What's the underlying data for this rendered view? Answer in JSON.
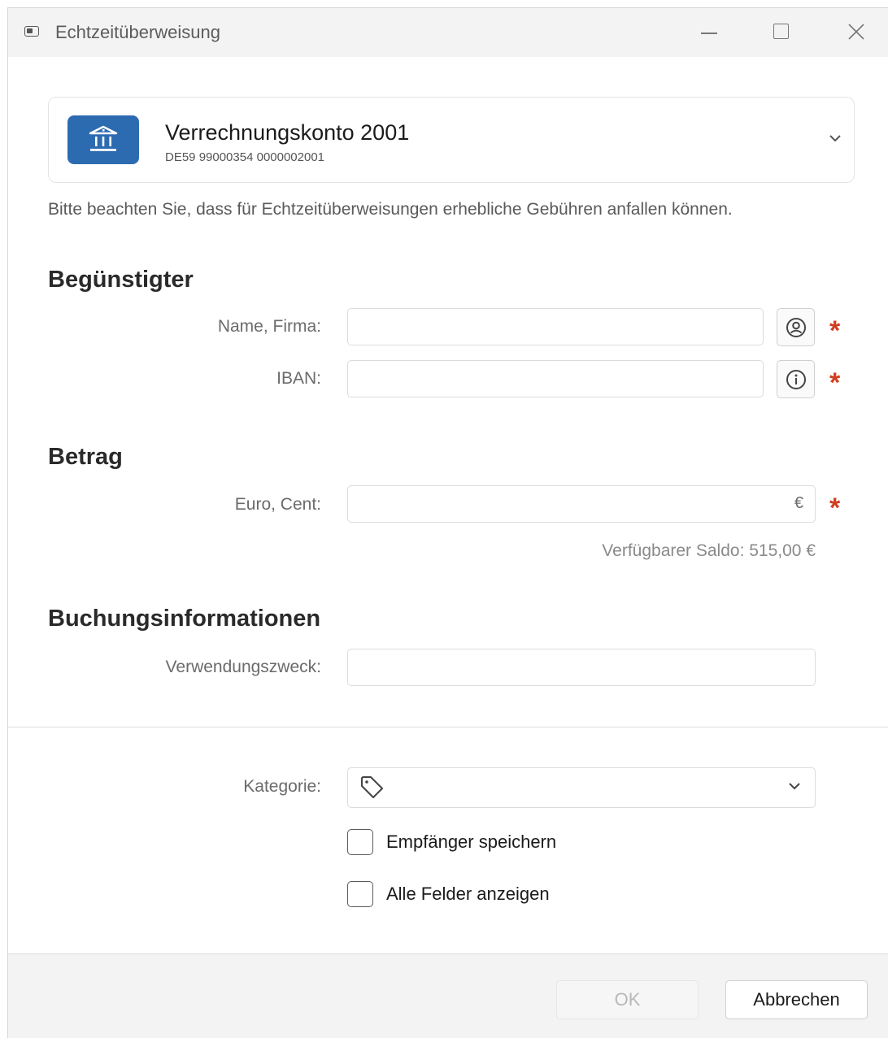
{
  "window": {
    "title": "Echtzeitüberweisung"
  },
  "account": {
    "name": "Verrechnungskonto 2001",
    "iban": "DE59 99000354 0000002001"
  },
  "notice": "Bitte beachten Sie, dass für Echtzeitüberweisungen erhebliche Gebühren anfallen können.",
  "beneficiary": {
    "title": "Begünstigter",
    "name_label": "Name, Firma:",
    "iban_label": "IBAN:",
    "name_value": "",
    "iban_value": ""
  },
  "amount": {
    "title": "Betrag",
    "label": "Euro, Cent:",
    "currency": "€",
    "value": "",
    "balance": "Verfügbarer Saldo: 515,00 €"
  },
  "booking": {
    "title": "Buchungsinformationen",
    "purpose_label": "Verwendungszweck:",
    "purpose_value": ""
  },
  "category": {
    "label": "Kategorie:",
    "value": ""
  },
  "options": {
    "save_recipient": "Empfänger speichern",
    "show_all_fields": "Alle Felder anzeigen"
  },
  "required_marker": "*",
  "buttons": {
    "ok": "OK",
    "cancel": "Abbrechen"
  },
  "colors": {
    "accent": "#2d6bb1",
    "required": "#d23d1e"
  }
}
